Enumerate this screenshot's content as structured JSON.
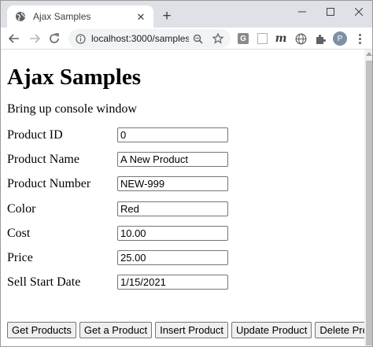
{
  "browser": {
    "tab_title": "Ajax Samples",
    "tab_close_glyph": "✕",
    "new_tab_glyph": "+",
    "url": "localhost:3000/samples...",
    "profile_initial": "P",
    "extension_g": "G",
    "extension_m": "m"
  },
  "page": {
    "heading": "Ajax Samples",
    "subtitle": "Bring up console window",
    "fields": [
      {
        "label": "Product ID",
        "value": "0"
      },
      {
        "label": "Product Name",
        "value": "A New Product"
      },
      {
        "label": "Product Number",
        "value": "NEW-999"
      },
      {
        "label": "Color",
        "value": "Red"
      },
      {
        "label": "Cost",
        "value": "10.00"
      },
      {
        "label": "Price",
        "value": "25.00"
      },
      {
        "label": "Sell Start Date",
        "value": "1/15/2021"
      }
    ],
    "buttons": {
      "get_products": "Get Products",
      "get_a_product": "Get a Product",
      "insert_product": "Insert Product",
      "update_product": "Update Product",
      "delete_product": "Delete Product"
    }
  },
  "colors": {
    "chrome_frame": "#dee1e6",
    "omnibox": "#f1f3f4",
    "button_face": "#efefef"
  }
}
